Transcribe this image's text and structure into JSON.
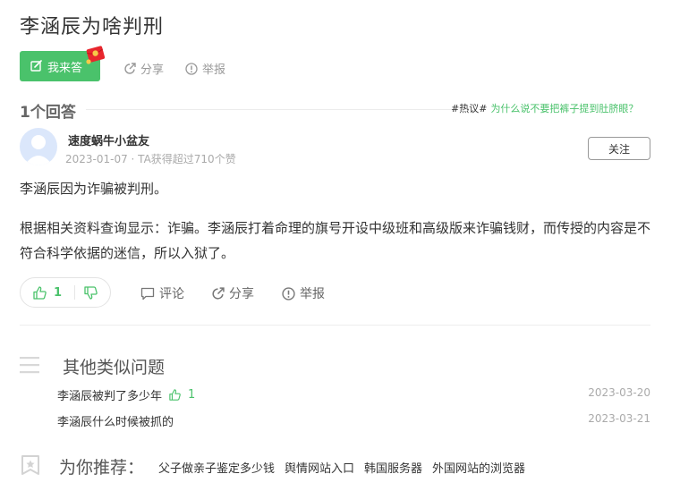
{
  "question": {
    "title": "李涵辰为啥判刑",
    "answer_button": "我来答",
    "share": "分享",
    "report": "举报"
  },
  "answers_header": {
    "count": "1个回答",
    "hot_tag": "#热议#",
    "hot_question": "为什么说不要把裤子提到肚脐眼？"
  },
  "answer": {
    "username": "速度蜗牛小盆友",
    "meta": "2023-01-07 · TA获得超过710个赞",
    "follow": "关注",
    "paragraphs": [
      "李涵辰因为诈骗被判刑。",
      "根据相关资料查询显示：诈骗。李涵辰打着命理的旗号开设中级班和高级版来诈骗钱财，而传授的内容是不符合科学依据的迷信，所以入狱了。"
    ],
    "likes": "1",
    "comment": "评论",
    "share": "分享",
    "report": "举报"
  },
  "similar": {
    "title": "其他类似问题",
    "items": [
      {
        "question": "李涵辰被判了多少年",
        "likes": "1",
        "date": "2023-03-20"
      },
      {
        "question": "李涵辰什么时候被抓的",
        "date": "2023-03-21"
      }
    ]
  },
  "recommend": {
    "title": "为你推荐：",
    "links": [
      "父子做亲子鉴定多少钱",
      "舆情网站入口",
      "韩国服务器",
      "外国网站的浏览器"
    ]
  },
  "colors": {
    "accent": "#4ac26b",
    "text": "#333333",
    "muted": "#999999",
    "redpacket": "#e8262d"
  }
}
